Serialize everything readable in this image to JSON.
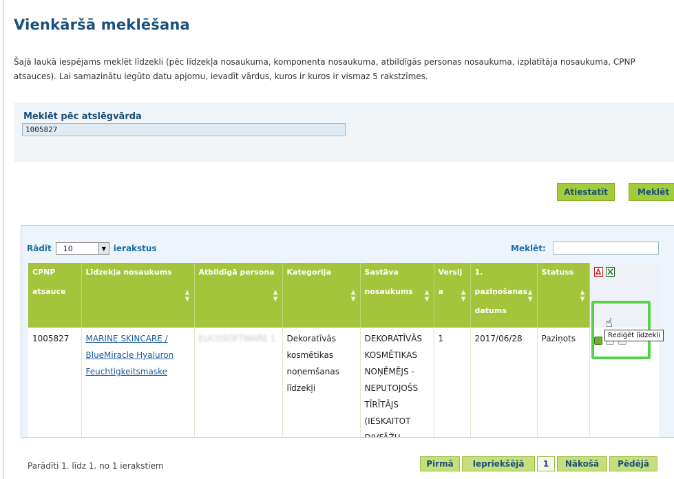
{
  "page": {
    "title": "Vienkāršā meklēšana",
    "intro": "Šajā laukā iespējams meklēt līdzekli (pēc līdzekļa nosaukuma, komponenta nosaukuma, atbildīgās personas nosaukuma, izplatītāja nosaukuma, CPNP atsauces). Lai samazinātu iegūto datu apjomu, ievadīt vārdus, kuros ir kuros ir vismaz 5 rakstzīmes."
  },
  "search": {
    "label": "Meklēt pēc atslēgvārda",
    "value": "1005827"
  },
  "buttons": {
    "reset": "Atiestatīt",
    "search": "Meklēt"
  },
  "table_controls": {
    "show_prefix": "Rādīt",
    "page_length": "10",
    "show_suffix": "ierakstus",
    "filter_label": "Meklēt:",
    "filter_value": ""
  },
  "columns": [
    {
      "label": "CPNP atsauce"
    },
    {
      "label": "Līdzekļa nosaukums"
    },
    {
      "label": "Atbildīgā persona"
    },
    {
      "label": "Kategorija"
    },
    {
      "label": "Sastāva nosaukums"
    },
    {
      "label": "Versij a"
    },
    {
      "label": "1. paziņošanas datums"
    },
    {
      "label": "Statuss"
    }
  ],
  "rows": [
    {
      "cpnp": "1005827",
      "product_name": "MARINE SKINCARE / BlueMiracle Hyaluron Feuchtigkeitsmaske",
      "responsible_person": "EUCOSOFTWARE 1",
      "category": "Dekoratīvās kosmētikas noņemšanas līdzekļi",
      "formulation": "DEKORATĪVĀS KOSMĒTIKAS NOŅĒMĒJS - NEPUTOJOŠS TĪRĪTĀJS (IESKAITOT DIVFĀŽU LĪDZEKĻUS)",
      "version": "1",
      "first_notification": "2017/06/28",
      "status": "Paziņots"
    }
  ],
  "export_icons": [
    "pdf-icon",
    "excel-icon"
  ],
  "row_action_icons": [
    "edit-icon",
    "view-icon",
    "copy-icon"
  ],
  "tooltip": "Rediģēt līdzekli",
  "footer": {
    "info": "Parādīti 1. līdz 1. no 1 ierakstiem",
    "first": "Pirmā",
    "previous": "Iepriekšējā",
    "current_page": "1",
    "next": "Nākošā",
    "last": "Pēdējā"
  },
  "colors": {
    "title": "#1a4f7a",
    "header_green": "#a3c43b",
    "highlight": "#55d24a"
  }
}
